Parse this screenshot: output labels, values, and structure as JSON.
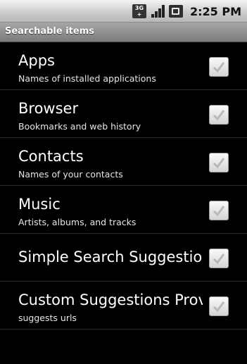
{
  "status_bar": {
    "network_label_top": "3G",
    "network_label_bottom": "+",
    "time": "2:25 PM",
    "icons": [
      "3g-icon",
      "signal-icon",
      "battery-icon"
    ]
  },
  "title_bar": {
    "title": "Searchable items"
  },
  "items": [
    {
      "title": "Apps",
      "summary": "Names of installed applications",
      "checked": true
    },
    {
      "title": "Browser",
      "summary": "Bookmarks and web history",
      "checked": true
    },
    {
      "title": "Contacts",
      "summary": "Names of your contacts",
      "checked": true
    },
    {
      "title": "Music",
      "summary": "Artists, albums, and tracks",
      "checked": true
    },
    {
      "title": "Simple Search Suggestions",
      "summary": "",
      "checked": true
    },
    {
      "title": "Custom Suggestions Provider",
      "summary": "suggests urls",
      "checked": true
    }
  ]
}
